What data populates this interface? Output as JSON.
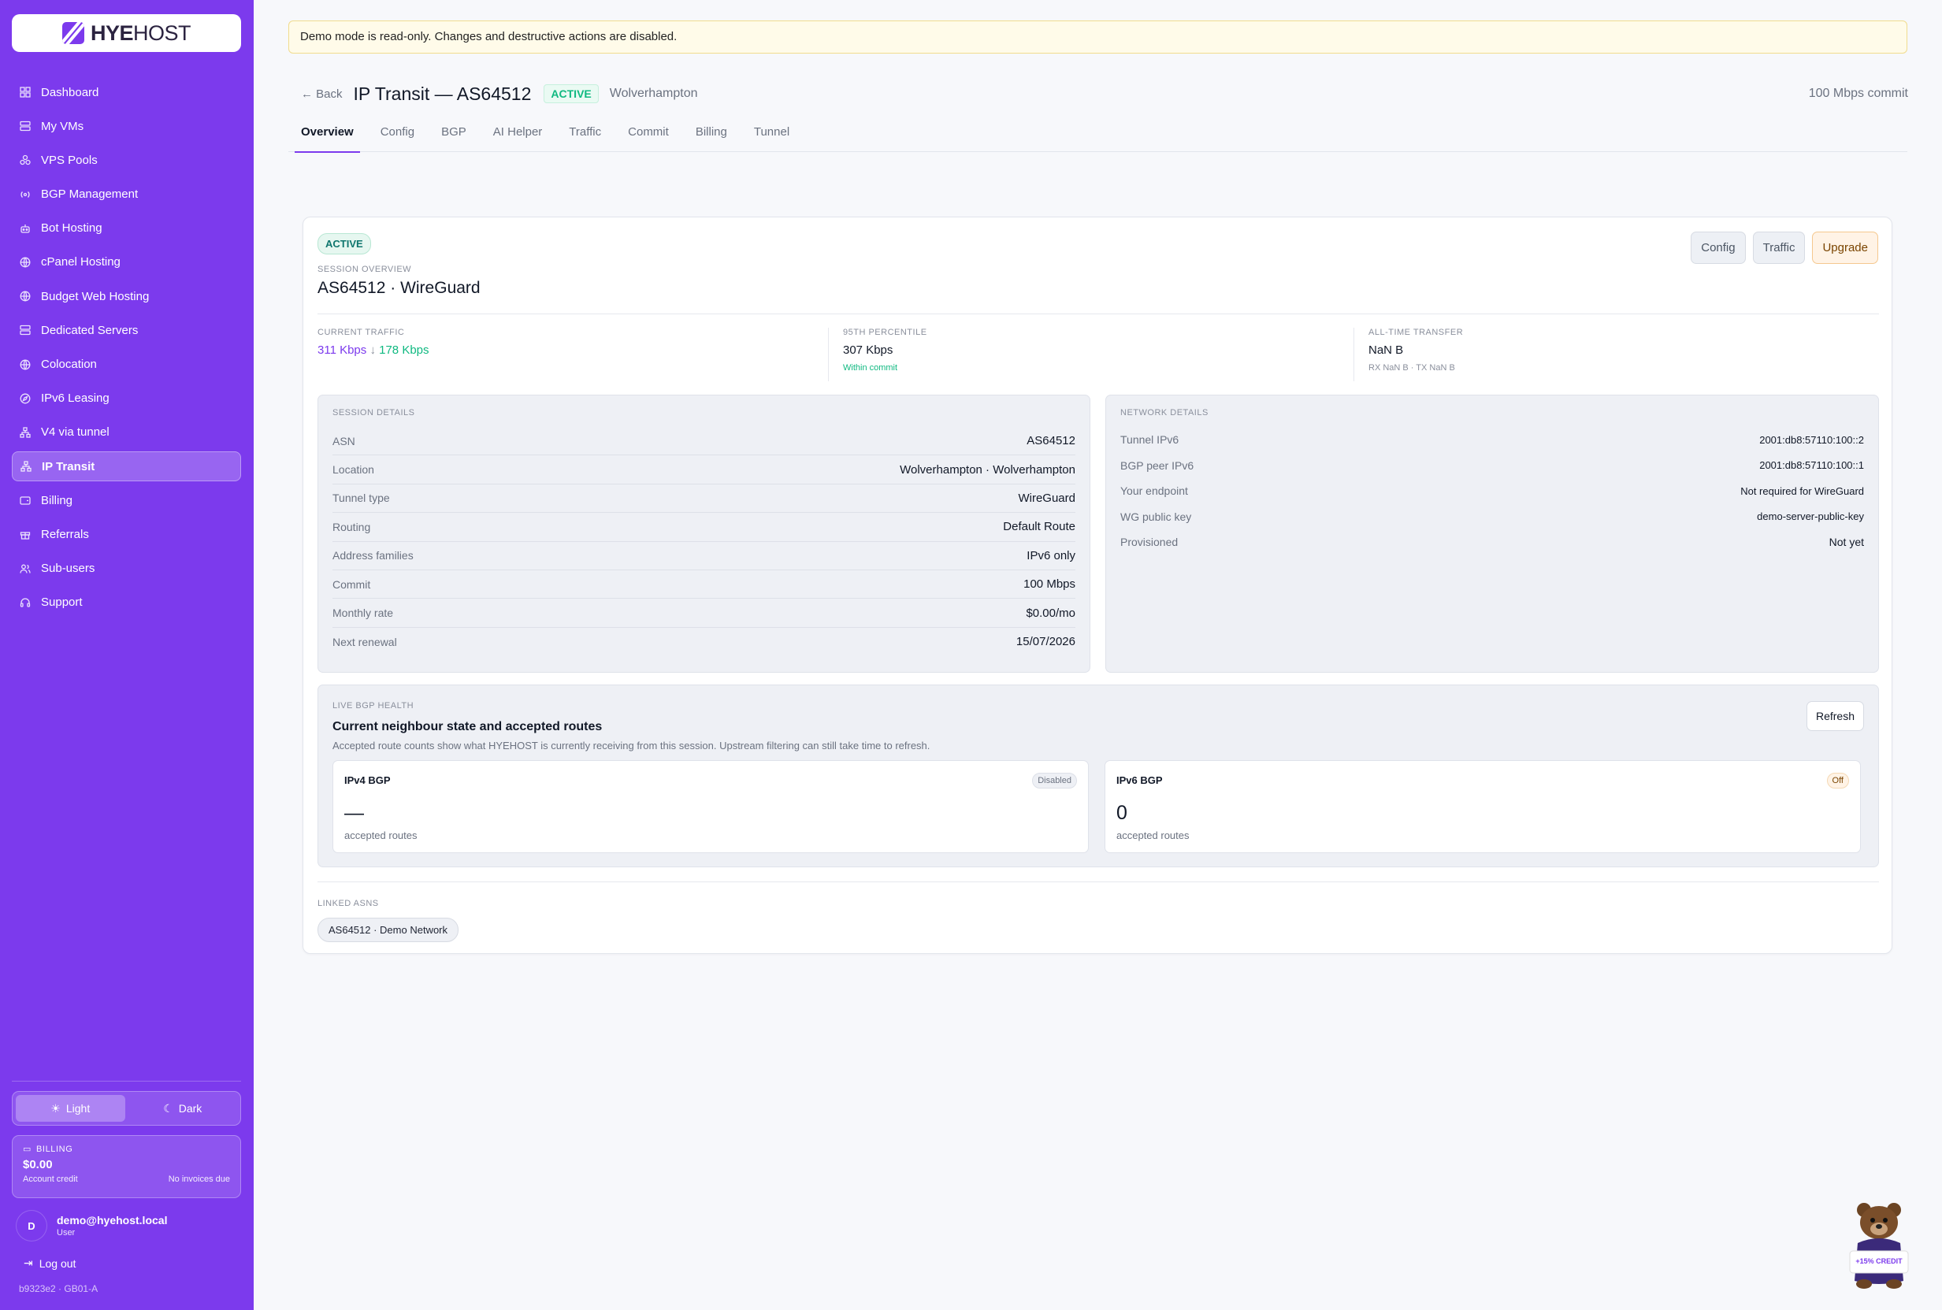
{
  "brand": {
    "name_bold": "HYE",
    "name_light": "HOST",
    "accent": "#7c3aed"
  },
  "sidebar": {
    "items": [
      {
        "label": "Dashboard",
        "icon": "grid-icon"
      },
      {
        "label": "My VMs",
        "icon": "server-icon"
      },
      {
        "label": "VPS Pools",
        "icon": "cluster-icon"
      },
      {
        "label": "BGP Management",
        "icon": "broadcast-icon"
      },
      {
        "label": "Bot Hosting",
        "icon": "bot-icon"
      },
      {
        "label": "cPanel Hosting",
        "icon": "globe-icon"
      },
      {
        "label": "Budget Web Hosting",
        "icon": "globe-icon"
      },
      {
        "label": "Dedicated Servers",
        "icon": "server-icon"
      },
      {
        "label": "Colocation",
        "icon": "globe-icon"
      },
      {
        "label": "IPv6 Leasing",
        "icon": "compass-icon"
      },
      {
        "label": "V4 via tunnel",
        "icon": "network-icon"
      },
      {
        "label": "IP Transit",
        "icon": "network-icon",
        "active": true
      },
      {
        "label": "Billing",
        "icon": "wallet-icon"
      },
      {
        "label": "Referrals",
        "icon": "gift-icon"
      },
      {
        "label": "Sub-users",
        "icon": "users-icon"
      },
      {
        "label": "Support",
        "icon": "headset-icon"
      }
    ],
    "theme": {
      "light": "Light",
      "dark": "Dark"
    },
    "billing": {
      "heading": "BILLING",
      "amount": "$0.00",
      "credit_label": "Account credit",
      "invoices": "No invoices due"
    },
    "user": {
      "initial": "D",
      "email": "demo@hyehost.local",
      "role": "User"
    },
    "logout": "Log out",
    "build": "b9323e2 · GB01-A"
  },
  "banner": "Demo mode is read-only. Changes and destructive actions are disabled.",
  "header": {
    "back": "← Back",
    "title": "IP Transit — AS64512",
    "status": "ACTIVE",
    "location": "Wolverhampton",
    "commit": "100 Mbps commit"
  },
  "tabs": [
    "Overview",
    "Config",
    "BGP",
    "AI Helper",
    "Traffic",
    "Commit",
    "Billing",
    "Tunnel"
  ],
  "card": {
    "status": "ACTIVE",
    "eyebrow": "SESSION OVERVIEW",
    "title": "AS64512 · WireGuard",
    "actions": {
      "config": "Config",
      "traffic": "Traffic",
      "upgrade": "Upgrade"
    },
    "metrics": {
      "current": {
        "label": "CURRENT TRAFFIC",
        "rx": "311 Kbps",
        "sep": " ↓ ",
        "tx": "178 Kbps"
      },
      "p95": {
        "label": "95TH PERCENTILE",
        "value": "307 Kbps",
        "sub": "Within commit"
      },
      "alltime": {
        "label": "ALL-TIME TRANSFER",
        "value": "NaN B",
        "sub": "RX NaN B · TX NaN B"
      }
    },
    "session": {
      "heading": "SESSION DETAILS",
      "rows": [
        {
          "label": "ASN",
          "value": "AS64512"
        },
        {
          "label": "Location",
          "value": "Wolverhampton · Wolverhampton"
        },
        {
          "label": "Tunnel type",
          "value": "WireGuard"
        },
        {
          "label": "Routing",
          "value": "Default Route"
        },
        {
          "label": "Address families",
          "value": "IPv6 only"
        },
        {
          "label": "Commit",
          "value": "100 Mbps"
        },
        {
          "label": "Monthly rate",
          "value": "$0.00/mo"
        },
        {
          "label": "Next renewal",
          "value": "15/07/2026"
        }
      ]
    },
    "network": {
      "heading": "NETWORK DETAILS",
      "rows": [
        {
          "label": "Tunnel IPv6",
          "value": "2001:db8:57110:100::2"
        },
        {
          "label": "BGP peer IPv6",
          "value": "2001:db8:57110:100::1"
        },
        {
          "label": "Your endpoint",
          "value": "Not required for WireGuard"
        },
        {
          "label": "WG public key",
          "value": "demo-server-public-key"
        },
        {
          "label": "Provisioned",
          "value": "Not yet"
        }
      ]
    },
    "bgp": {
      "eyebrow": "LIVE BGP HEALTH",
      "title": "Current neighbour state and accepted routes",
      "desc": "Accepted route counts show what HYEHOST is currently receiving from this session. Upstream filtering can still take time to refresh.",
      "refresh": "Refresh",
      "v4": {
        "name": "IPv4 BGP",
        "badge": "Disabled",
        "count": "—",
        "sub": "accepted routes"
      },
      "v6": {
        "name": "IPv6 BGP",
        "badge": "Off",
        "count": "0",
        "sub": "accepted routes"
      }
    },
    "linked": {
      "eyebrow": "LINKED ASNS",
      "chip": "AS64512 · Demo Network"
    }
  },
  "mascot": {
    "badge": "+15% CREDIT"
  }
}
